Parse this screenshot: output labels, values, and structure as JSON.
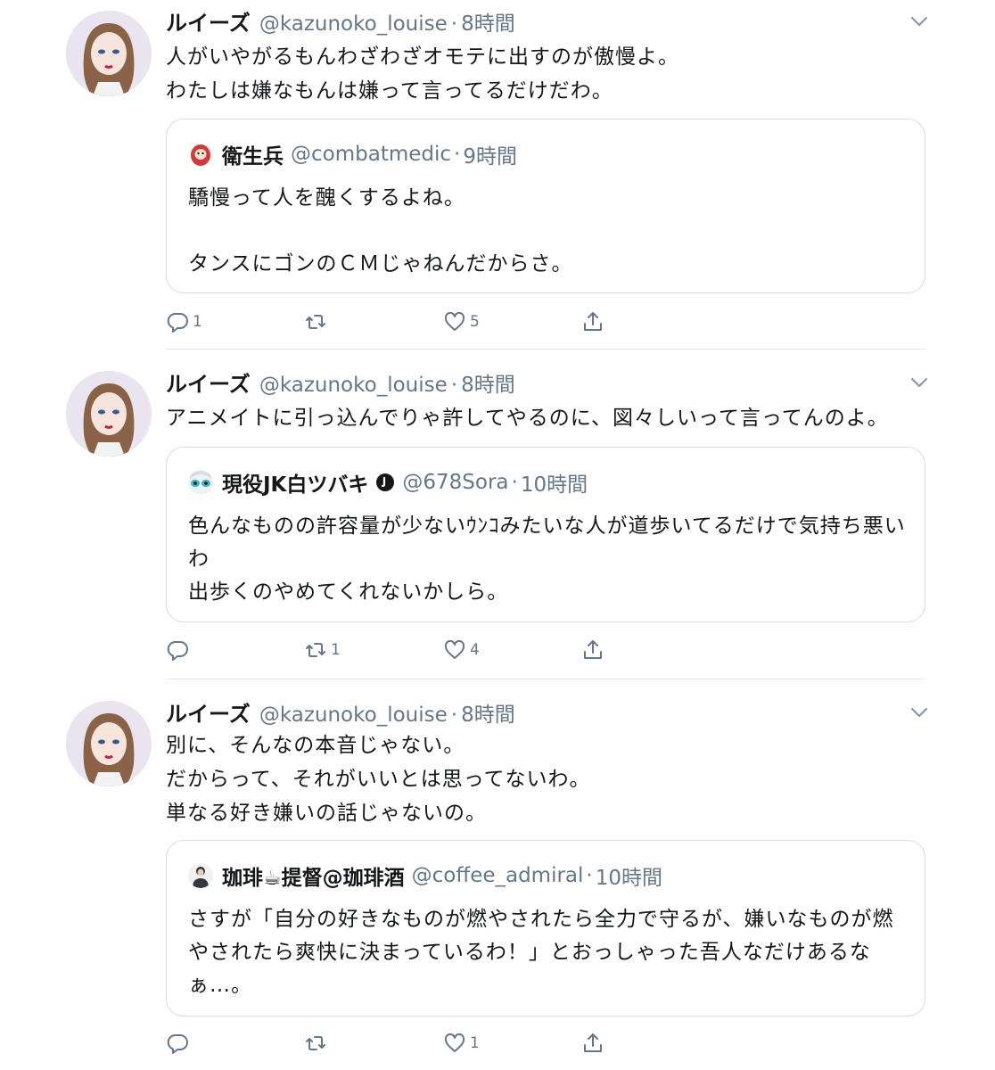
{
  "tweets": [
    {
      "name": "ルイーズ",
      "handle": "@kazunoko_louise",
      "dot": "·",
      "time": "8時間",
      "text": "人がいやがるもんわざわざオモテに出すのが傲慢よ。\nわたしは嫌なもんは嫌って言ってるだけだわ。",
      "quote": {
        "name": "衛生兵",
        "handle": "@combatmedic",
        "dot": "·",
        "time": "9時間",
        "text": "驕慢って人を醜くするよね。\n\nタンスにゴンのＣＭじゃねんだからさ。"
      },
      "replies": "1",
      "retweets": "",
      "likes": "5"
    },
    {
      "name": "ルイーズ",
      "handle": "@kazunoko_louise",
      "dot": "·",
      "time": "8時間",
      "text": "アニメイトに引っ込んでりゃ許してやるのに、図々しいって言ってんのよ。",
      "quote": {
        "name": "現役JK白ツバキ",
        "handle": "@678Sora",
        "dot": "·",
        "time": "10時間",
        "text": "色んなものの許容量が少ないｳﾝｺみたいな人が道歩いてるだけで気持ち悪いわ\n出歩くのやめてくれないかしら。"
      },
      "replies": "",
      "retweets": "1",
      "likes": "4"
    },
    {
      "name": "ルイーズ",
      "handle": "@kazunoko_louise",
      "dot": "·",
      "time": "8時間",
      "text": "別に、そんなの本音じゃない。\nだからって、それがいいとは思ってないわ。\n単なる好き嫌いの話じゃないの。",
      "quote": {
        "name": "珈琲☕提督@珈琲酒",
        "handle": "@coffee_admiral",
        "dot": "·",
        "time": "10時間",
        "text": "さすが「自分の好きなものが燃やされたら全力で守るが、嫌いなものが燃やされたら爽快に決まっているわ！」とおっしゃった吾人なだけあるなぁ…。"
      },
      "replies": "",
      "retweets": "",
      "likes": "1"
    }
  ],
  "icons": {
    "reply": "speech-bubble-outline",
    "retweet": "retweet-arrows",
    "like": "heart-outline",
    "share": "share-upload",
    "menu": "chevron-down",
    "verified": "verified-badge"
  },
  "colors": {
    "text": "#14171a",
    "muted": "#657786",
    "border": "#d7dde2",
    "icon": "#657786"
  }
}
